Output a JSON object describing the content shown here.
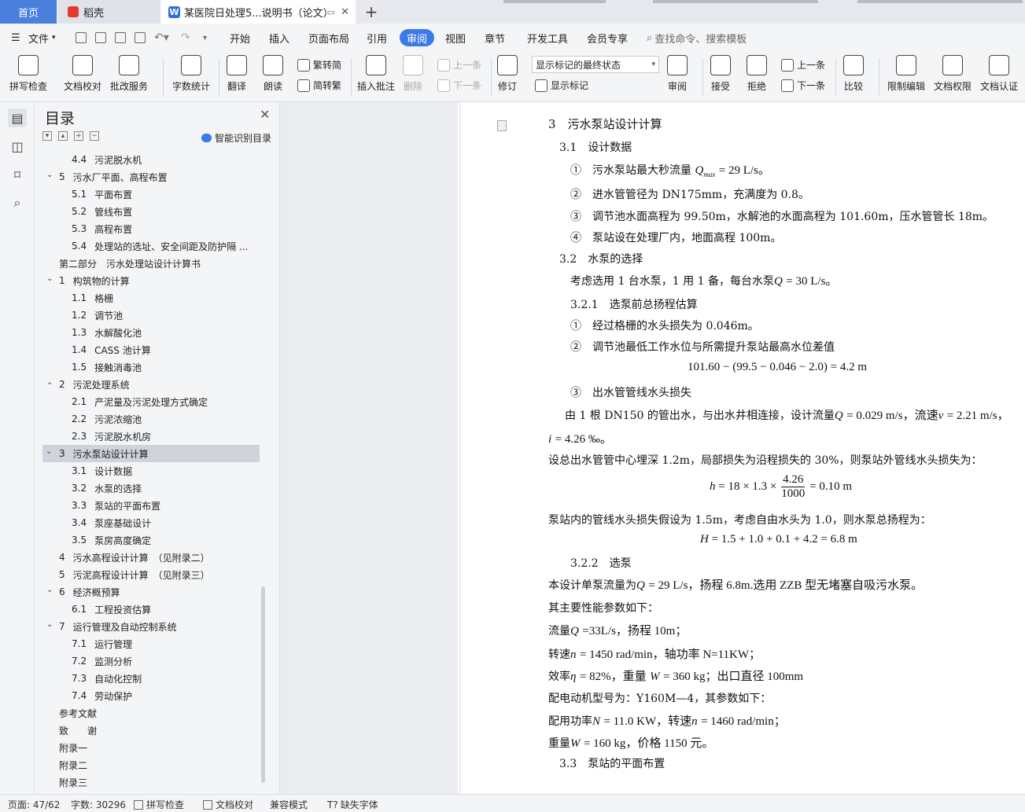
{
  "tabs": {
    "home": "首页",
    "wps": "稻壳",
    "doc": "某医院日处理5...说明书（论文）",
    "plus": "+"
  },
  "menu": {
    "file": "文件",
    "items": [
      "开始",
      "插入",
      "页面布局",
      "引用",
      "审阅",
      "视图",
      "章节",
      "开发工具",
      "会员专享"
    ],
    "selected": "审阅",
    "search": "查找命令、搜索模板"
  },
  "ribbon": {
    "spell": "拼写检查",
    "proof": "文档校对",
    "batch": "批改服务",
    "wordcount": "字数统计",
    "translate": "翻译",
    "read": "朗读",
    "to_trad": "繁转简",
    "to_simp": "简转繁",
    "insert_comment": "插入批注",
    "delete": "删除",
    "prev": "上一条",
    "next": "下一条",
    "revise": "修订",
    "markup_dropdown": "显示标记的最终状态",
    "show_markup": "显示标记",
    "review": "审阅",
    "accept": "接受",
    "reject": "拒绝",
    "prev2": "上一条",
    "next2": "下一条",
    "compare": "比较",
    "restrict": "限制编辑",
    "rights": "文档权限",
    "certify": "文档认证"
  },
  "toc": {
    "title": "目录",
    "smart": "智能识别目录",
    "items": [
      {
        "num": "4.4",
        "text": "污泥脱水机"
      },
      {
        "num": "5",
        "text": "污水厂平面、高程布置"
      },
      {
        "num": "5.1",
        "text": "平面布置"
      },
      {
        "num": "5.2",
        "text": "管线布置"
      },
      {
        "num": "5.3",
        "text": "高程布置"
      },
      {
        "num": "5.4",
        "text": "处理站的选址、安全间距及防护隔 ..."
      },
      {
        "num": "",
        "text": "第二部分　污水处理站设计计算书"
      },
      {
        "num": "1",
        "text": "构筑物的计算"
      },
      {
        "num": "1.1",
        "text": "格栅"
      },
      {
        "num": "1.2",
        "text": "调节池"
      },
      {
        "num": "1.3",
        "text": "水解酸化池"
      },
      {
        "num": "1.4",
        "text": "CASS 池计算"
      },
      {
        "num": "1.5",
        "text": "接触消毒池"
      },
      {
        "num": "2",
        "text": "污泥处理系统"
      },
      {
        "num": "2.1",
        "text": "产泥量及污泥处理方式确定"
      },
      {
        "num": "2.2",
        "text": "污泥浓缩池"
      },
      {
        "num": "2.3",
        "text": "污泥脱水机房"
      },
      {
        "num": "3",
        "text": "污水泵站设计计算"
      },
      {
        "num": "3.1",
        "text": "设计数据"
      },
      {
        "num": "3.2",
        "text": "水泵的选择"
      },
      {
        "num": "3.3",
        "text": "泵站的平面布置"
      },
      {
        "num": "3.4",
        "text": "泵座基础设计"
      },
      {
        "num": "3.5",
        "text": "泵房高度确定"
      },
      {
        "num": "4",
        "text": "污水高程设计计算　（见附录二）"
      },
      {
        "num": "5",
        "text": "污泥高程设计计算　（见附录三）"
      },
      {
        "num": "6",
        "text": "经济概预算"
      },
      {
        "num": "6.1",
        "text": "工程投资估算"
      },
      {
        "num": "7",
        "text": "运行管理及自动控制系统"
      },
      {
        "num": "7.1",
        "text": "运行管理"
      },
      {
        "num": "7.2",
        "text": "监测分析"
      },
      {
        "num": "7.3",
        "text": "自动化控制"
      },
      {
        "num": "7.4",
        "text": "劳动保护"
      },
      {
        "num": "",
        "text": "参考文献"
      },
      {
        "num": "",
        "text": "致　　谢"
      },
      {
        "num": "",
        "text": "附录一"
      },
      {
        "num": "",
        "text": "附录二"
      },
      {
        "num": "",
        "text": "附录三"
      }
    ]
  },
  "doc": {
    "h3": "3　污水泵站设计计算",
    "h31": "3.1　设计数据",
    "p1a": "①　污水泵站最大秒流量",
    "p1b": "= 29 L/s。",
    "p2": "②　进水管管径为 DN175mm，充满度为 0.8。",
    "p3": "③　调节池水面高程为 99.50m，水解池的水面高程为 101.60m，压水管管长 18m。",
    "p4": "④　泵站设在处理厂内，地面高程 100m。",
    "h32": "3.2　水泵的选择",
    "p5a": "考虑选用 1 台水泵，1 用 1 备，每台水泵",
    "p5b": "= 30 L/s。",
    "h321": "3.2.1　选泵前总扬程估算",
    "p6": "①　经过格栅的水头损失为 0.046m。",
    "p7": "②　调节池最低工作水位与所需提升泵站最高水位差值",
    "f1": "101.60 − (99.5 − 0.046 − 2.0) = 4.2 m",
    "p8": "③　出水管管线水头损失",
    "p9a": "由 1 根 DN150 的管出水，与出水井相连接，设计流量",
    "p9b": "= 0.029 m/s，流速",
    "p9c": "= 2.21 m/s，",
    "p10": "= 4.26 ‰。",
    "p11": "设总出水管管中心埋深 1.2m，局部损失为沿程损失的 30%，则泵站外管线水头损失为：",
    "f2a": "= 18 × 1.3 ×",
    "f2num": "4.26",
    "f2den": "1000",
    "f2b": "= 0.10 m",
    "p12": "泵站内的管线水头损失假设为 1.5m，考虑自由水头为 1.0，则水泵总扬程为：",
    "f3": "= 1.5 + 1.0 + 0.1 + 4.2 = 6.8 m",
    "h322": "3.2.2　选泵",
    "p13a": "本设计单泵流量为",
    "p13b": "= 29 L/s，扬程 6.8m.选用 ZZB 型无堵塞自吸污水泵。",
    "p14": "其主要性能参数如下：",
    "p15a": "流量",
    "p15b": "=33L/s，扬程 10m；",
    "p16a": "转速",
    "p16b": "= 1450 rad/min，轴功率 N=11KW；",
    "p17a": "效率",
    "p17b": "= 82%，重量",
    "p17c": "= 360 kg；出口直径 100mm",
    "p18": "配电动机型号为：Y160M—4，其参数如下：",
    "p19a": "配用功率",
    "p19b": "= 11.0 KW，转速",
    "p19c": "= 1460 rad/min；",
    "p20a": "重量",
    "p20b": "= 160 kg，价格 1150 元。",
    "h33": "3.3　泵站的平面布置"
  },
  "status": {
    "page": "页面: 47/62",
    "words": "字数: 30296",
    "spell": "拼写检查",
    "proof": "文档校对",
    "compat": "兼容模式",
    "missing_font": "缺失字体"
  }
}
